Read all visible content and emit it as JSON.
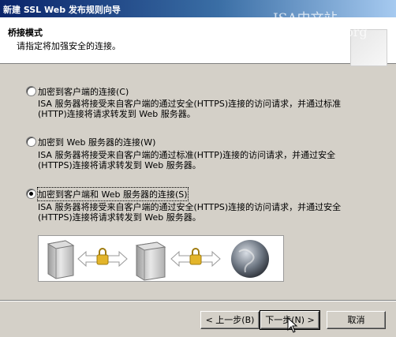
{
  "window": {
    "title": "新建 SSL Web 发布规则向导"
  },
  "watermark": {
    "line1": "ISA中文站",
    "line2": "http://www.isacn.org"
  },
  "header": {
    "title": "桥接模式",
    "subtitle": "请指定将加强安全的连接。"
  },
  "options": [
    {
      "label": "加密到客户端的连接(C)",
      "desc": "ISA 服务器将接受来自客户端的通过安全(HTTPS)连接的访问请求，并通过标准(HTTP)连接将请求转发到 Web 服务器。",
      "selected": false
    },
    {
      "label": "加密到 Web 服务器的连接(W)",
      "desc": "ISA 服务器将接受来自客户端的通过标准(HTTP)连接的访问请求，并通过安全(HTTPS)连接将请求转发到 Web 服务器。",
      "selected": false
    },
    {
      "label": "加密到客户端和 Web 服务器的连接(S)",
      "desc": "ISA 服务器将接受来自客户端的通过安全(HTTPS)连接的访问请求，并通过安全(HTTPS)连接将请求转发到 Web 服务器。",
      "selected": true
    }
  ],
  "diagram": {
    "icons": [
      "server-icon",
      "arrow-lock-icon",
      "isa-server-icon",
      "arrow-lock-icon",
      "globe-icon"
    ]
  },
  "buttons": {
    "back": "< 上一步(B)",
    "next": "下一步(N) >",
    "cancel": "取消"
  }
}
